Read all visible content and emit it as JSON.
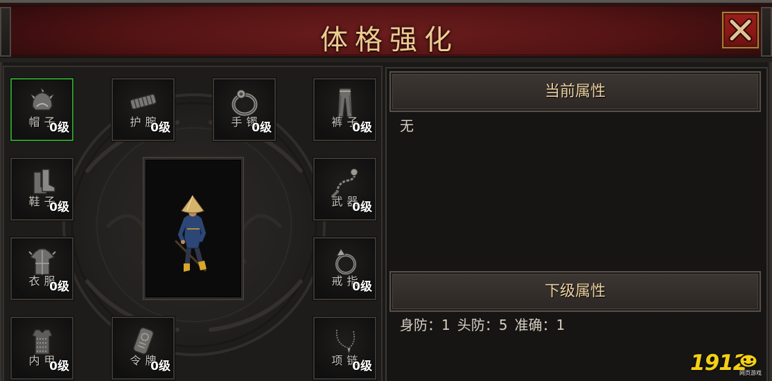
{
  "window": {
    "title": "体格强化",
    "close_icon": "close-icon"
  },
  "equipment_slots": [
    {
      "name": "帽子",
      "level": "0级",
      "icon": "helmet-icon",
      "selected": true
    },
    {
      "name": "护腕",
      "level": "0级",
      "icon": "bracer-icon",
      "selected": false
    },
    {
      "name": "手镯",
      "level": "0级",
      "icon": "bracelet-icon",
      "selected": false
    },
    {
      "name": "裤子",
      "level": "0级",
      "icon": "pants-icon",
      "selected": false
    },
    {
      "name": "鞋子",
      "level": "0级",
      "icon": "boots-icon",
      "selected": false
    },
    {
      "name": "武器",
      "level": "0级",
      "icon": "weapon-icon",
      "selected": false
    },
    {
      "name": "衣服",
      "level": "0级",
      "icon": "armor-icon",
      "selected": false
    },
    {
      "name": "戒指",
      "level": "0级",
      "icon": "ring-icon",
      "selected": false
    },
    {
      "name": "内甲",
      "level": "0级",
      "icon": "inner-armor-icon",
      "selected": false
    },
    {
      "name": "令牌",
      "level": "0级",
      "icon": "token-icon",
      "selected": false
    },
    {
      "name": "项链",
      "level": "0级",
      "icon": "necklace-icon",
      "selected": false
    }
  ],
  "character_preview": {
    "icon": "character-figure"
  },
  "current_attributes": {
    "title": "当前属性",
    "value": "无"
  },
  "next_attributes": {
    "title": "下级属性",
    "items": [
      "身防：1",
      "头防：5",
      "准确：1"
    ]
  },
  "watermark": {
    "brand": "1912",
    "tagline": "网页游戏",
    "icon": "smiley-badge-icon"
  },
  "colors": {
    "title_gold": "#eccb91",
    "header_red": "#531314",
    "selected_border": "#2f9a2f",
    "close_red": "#8a1816",
    "panel_text": "#d8cfc1",
    "section_title": "#ecd1a1",
    "level_text": "#ffffff",
    "brand_yellow": "#f4d011"
  }
}
